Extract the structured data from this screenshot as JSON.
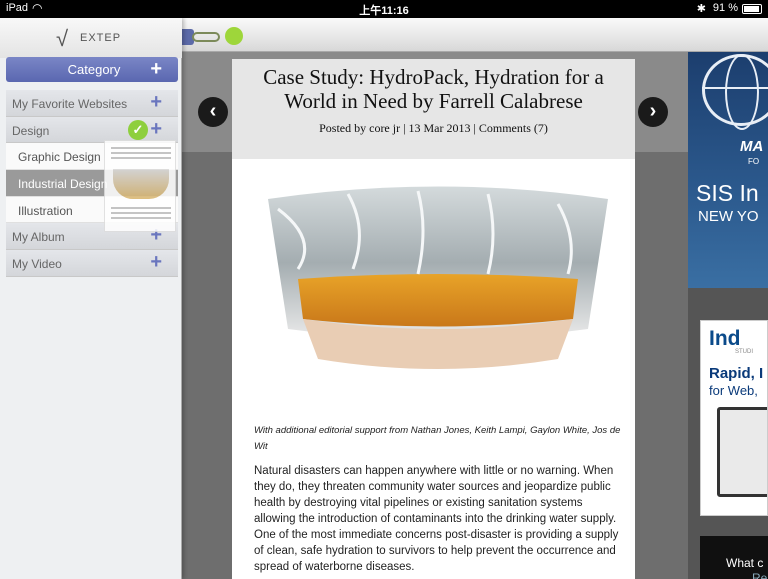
{
  "status_bar": {
    "device": "iPad",
    "time": "上午11:16",
    "battery": "91 %",
    "bluetooth": "✱"
  },
  "sidebar": {
    "logo_text": "EXTEP",
    "category_button": "Category",
    "items": [
      {
        "label": "My Favorite Websites",
        "type": "group"
      },
      {
        "label": "Design",
        "type": "group"
      },
      {
        "label": "Graphic Design",
        "type": "sub"
      },
      {
        "label": "Industrial Design",
        "type": "sub",
        "selected": true
      },
      {
        "label": "Illustration",
        "type": "sub"
      },
      {
        "label": "My Album",
        "type": "group"
      },
      {
        "label": "My Video",
        "type": "group"
      }
    ]
  },
  "article": {
    "title": "Case Study: HydroPack, Hydration for a World in Need by Farrell Calabrese",
    "meta": "Posted by core jr  |  13 Mar 2013  |  Comments (7)",
    "caption": "With additional editorial support from Nathan Jones, Keith Lampi, Gaylon White, Jos de Wit",
    "body": "Natural disasters can happen anywhere with little or no warning. When they do, they threaten community water sources and jeopardize public health by destroying vital pipelines or existing sanitation systems allowing the introduction of contaminants into the drinking water supply. One of the most immediate concerns post-disaster is providing a supply of clean, safe hydration to survivors to help prevent the occurrence and spread of waterborne diseases."
  },
  "ads": {
    "ad1_line1": "MA",
    "ad1_line2": "FO",
    "ad1_line3": "SIS In",
    "ad1_line4": "NEW YO",
    "ad2_logo": "In",
    "ad2_logo2": "d",
    "ad2_studio": "STUDI",
    "ad2_line1": "Rapid, I",
    "ad2_line2": "for Web,",
    "ad3_line1": "What c",
    "ad3_line2": "Re"
  },
  "colors": {
    "accent": "#5a67b0",
    "check": "#8ecf3e"
  }
}
